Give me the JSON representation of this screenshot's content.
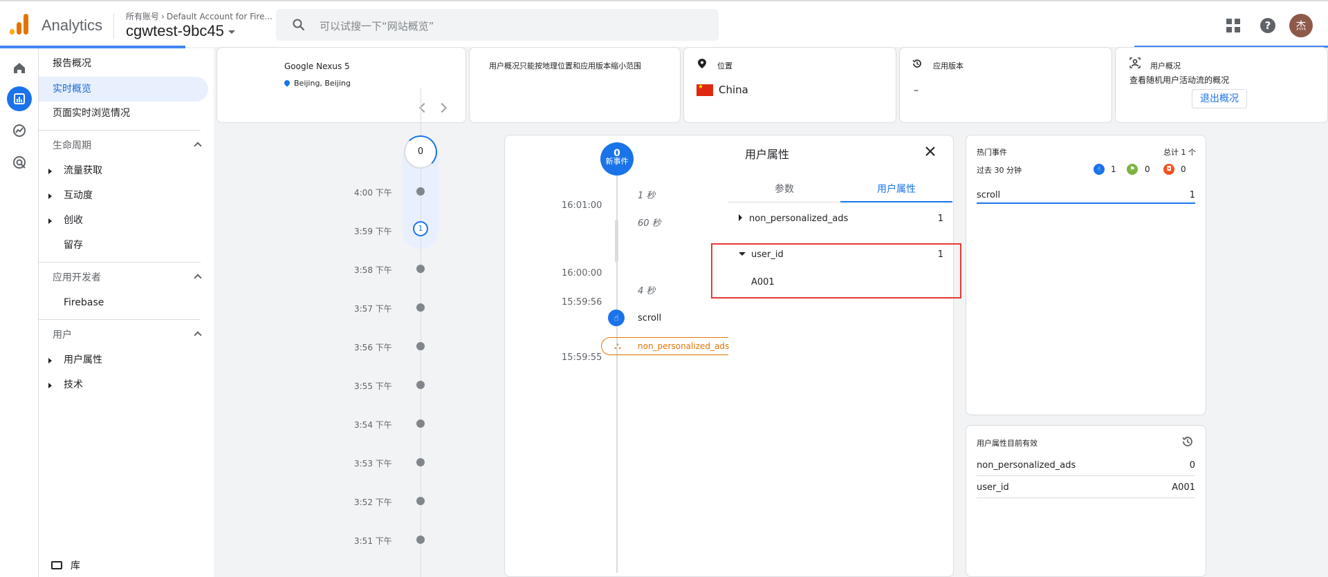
{
  "header": {
    "app_title": "Analytics",
    "breadcrumb_root": "所有账号",
    "breadcrumb_account": "Default Account for Fire...",
    "property": "cgwtest-9bc45",
    "search_placeholder": "可以试搜一下“网站概览”",
    "avatar_initial": "杰",
    "help_glyph": "?"
  },
  "sidebar": {
    "report_overview": "报告概况",
    "realtime_overview": "实时概览",
    "page_realtime": "页面实时浏览情况",
    "lifecycle": {
      "title": "生命周期",
      "items": [
        "流量获取",
        "互动度",
        "创收",
        "留存"
      ]
    },
    "app_developer": {
      "title": "应用开发者",
      "items": [
        "Firebase"
      ]
    },
    "user": {
      "title": "用户",
      "items": [
        "用户属性",
        "技术"
      ]
    },
    "library": "库"
  },
  "top_cards": {
    "device": {
      "name": "Google Nexus 5",
      "location": "Beijing, Beijing"
    },
    "notice": "用户概况只能按地理位置和应用版本缩小范围",
    "location": {
      "label": "位置",
      "country": "China"
    },
    "app_version": {
      "label": "应用版本",
      "value": "–"
    },
    "user_snapshot": {
      "label": "用户概况",
      "desc": "查看随机用户活动流的概况",
      "exit_button": "退出概况"
    }
  },
  "minute_timeline": {
    "current_count": "0",
    "highlight_count": "1",
    "minutes": [
      "4:00 下午",
      "3:59 下午",
      "3:58 下午",
      "3:57 下午",
      "3:56 下午",
      "3:55 下午",
      "3:54 下午",
      "3:53 下午",
      "3:52 下午",
      "3:51 下午"
    ]
  },
  "event_stream": {
    "new_events_count": "0",
    "new_events_label": "新事件",
    "gaps": [
      "1 秒",
      "60 秒",
      "4 秒"
    ],
    "timestamps": [
      "16:01:00",
      "16:00:00",
      "15:59:56",
      "15:59:55"
    ],
    "events": [
      {
        "name": "scroll",
        "color": "#1a73e8",
        "icon": "touch-icon"
      },
      {
        "name": "non_personalized_ads",
        "color": "#e37400",
        "icon": "shapes-icon"
      }
    ]
  },
  "user_attributes_panel": {
    "title": "用户属性",
    "tabs": [
      "参数",
      "用户属性"
    ],
    "active_tab": "用户属性",
    "rows": [
      {
        "name": "non_personalized_ads",
        "count": "1",
        "expanded": false
      },
      {
        "name": "user_id",
        "count": "1",
        "expanded": true,
        "child": "A001"
      }
    ]
  },
  "hot_events": {
    "title": "热门事件",
    "total": "总计 1 个",
    "period": "过去 30 分钟",
    "legend": [
      {
        "icon": "touch-icon",
        "value": "1",
        "color": "#1a73e8"
      },
      {
        "icon": "flag-icon",
        "value": "0",
        "color": "#7cb342"
      },
      {
        "icon": "gift-icon",
        "value": "0",
        "color": "#f4511e"
      }
    ],
    "rows": [
      {
        "name": "scroll",
        "value": "1"
      }
    ]
  },
  "active_user_props": {
    "title": "用户属性目前有效",
    "rows": [
      {
        "name": "non_personalized_ads",
        "value": "0"
      },
      {
        "name": "user_id",
        "value": "A001"
      }
    ]
  }
}
